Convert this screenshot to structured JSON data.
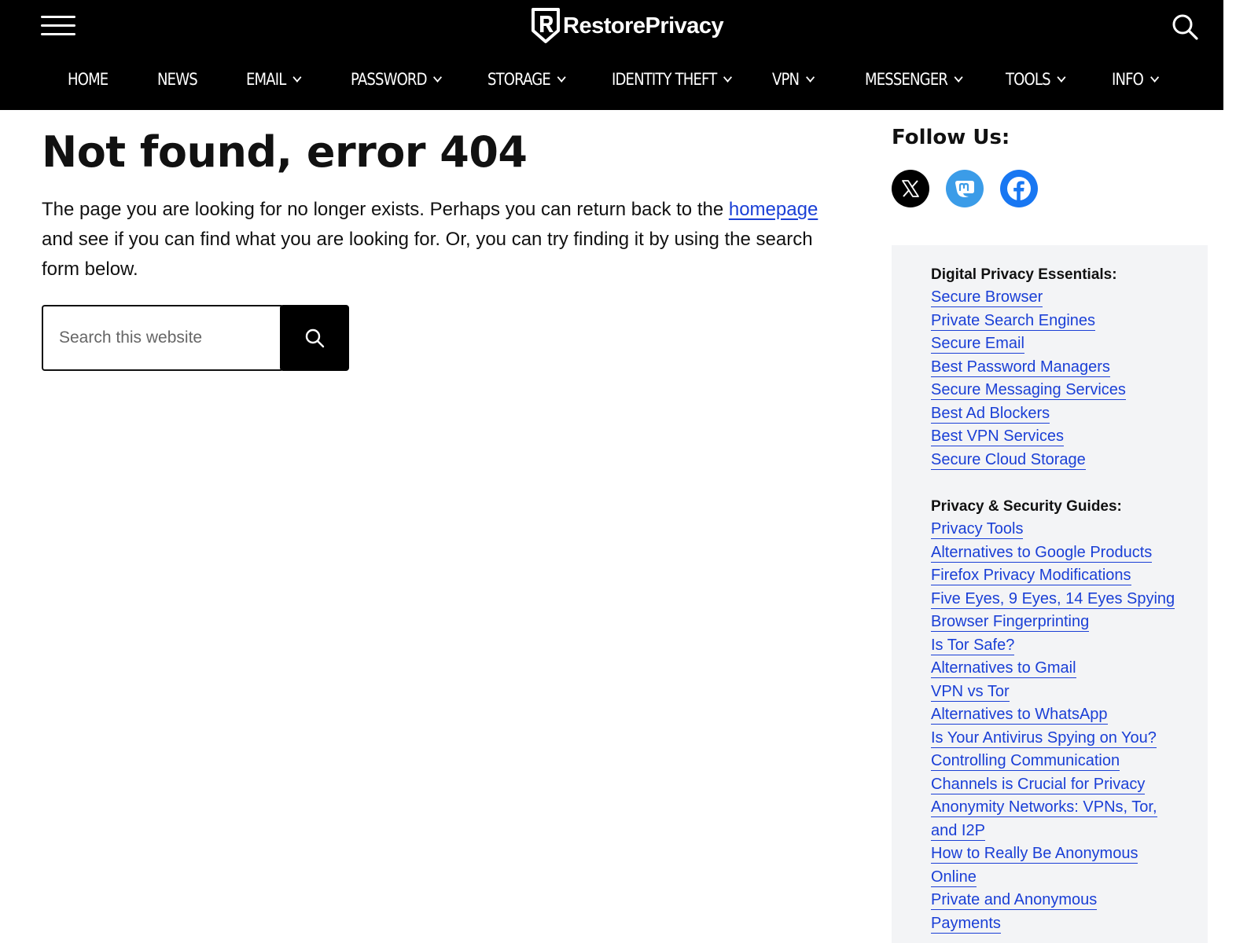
{
  "site": {
    "logo_text": "RestorePrivacy",
    "colors": {
      "header_bg": "#000000",
      "link": "#1a3fd6",
      "mastodon": "#3b9ce8",
      "facebook": "#1877f2",
      "sidebar_bg": "#f3f4f6"
    }
  },
  "header": {
    "menu_icon": "hamburger-menu-icon",
    "search_icon": "search-icon",
    "nav": [
      {
        "label": "HOME",
        "dropdown": false
      },
      {
        "label": "NEWS",
        "dropdown": false
      },
      {
        "label": "EMAIL",
        "dropdown": true
      },
      {
        "label": "PASSWORD",
        "dropdown": true
      },
      {
        "label": "STORAGE",
        "dropdown": true
      },
      {
        "label": "IDENTITY THEFT",
        "dropdown": true
      },
      {
        "label": "VPN",
        "dropdown": true
      },
      {
        "label": "MESSENGER",
        "dropdown": true
      },
      {
        "label": "TOOLS",
        "dropdown": true
      },
      {
        "label": "INFO",
        "dropdown": true
      }
    ]
  },
  "main": {
    "title": "Not found, error 404",
    "intro_before": "The page you are looking for no longer exists. Perhaps you can return back to the ",
    "intro_link": "homepage",
    "intro_after": " and see if you can find what you are looking for. Or, you can try finding it by using the search form below.",
    "search": {
      "placeholder": "Search this website",
      "value": "",
      "button_icon": "search-icon"
    }
  },
  "sidebar": {
    "follow_title": "Follow Us:",
    "social": [
      {
        "name": "X",
        "icon": "x-icon"
      },
      {
        "name": "Mastodon",
        "icon": "mastodon-icon"
      },
      {
        "name": "Facebook",
        "icon": "facebook-icon"
      }
    ],
    "essentials": {
      "heading": "Digital Privacy Essentials:",
      "links": [
        "Secure Browser",
        "Private Search Engines",
        "Secure Email",
        "Best Password Managers",
        "Secure Messaging Services",
        "Best Ad Blockers",
        "Best VPN Services",
        "Secure Cloud Storage"
      ]
    },
    "guides": {
      "heading": "Privacy & Security Guides:",
      "links": [
        "Privacy Tools",
        "Alternatives to Google Products",
        "Firefox Privacy Modifications",
        "Five Eyes, 9 Eyes, 14 Eyes Spying",
        "Browser Fingerprinting",
        "Is Tor Safe?",
        "Alternatives to Gmail",
        "VPN vs Tor",
        "Alternatives to WhatsApp",
        "Is Your Antivirus Spying on You?",
        "Controlling Communication",
        "Channels is Crucial for Privacy",
        "Anonymity Networks: VPNs, Tor,",
        "and I2P",
        "How to Really Be Anonymous",
        "Online",
        "Private and Anonymous",
        "Payments"
      ]
    }
  }
}
